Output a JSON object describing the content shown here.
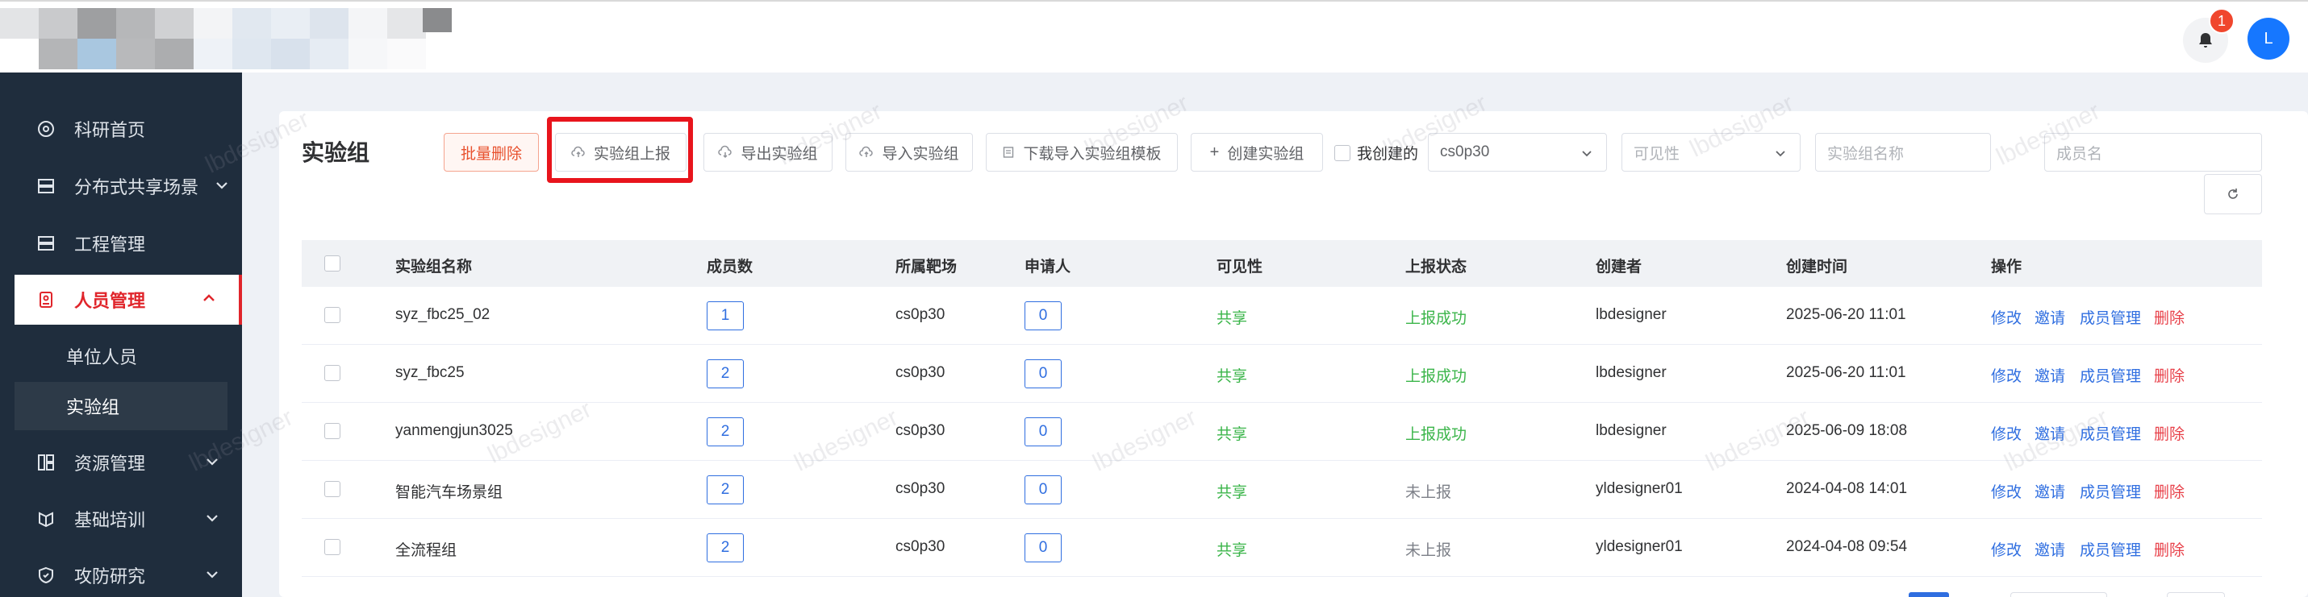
{
  "header": {
    "notification_count": "1",
    "avatar_initial": "L"
  },
  "sidebar": {
    "items": [
      {
        "label": "科研首页",
        "icon": "dashboard-icon"
      },
      {
        "label": "分布式共享场景",
        "icon": "server-icon"
      },
      {
        "label": "工程管理",
        "icon": "server-icon"
      },
      {
        "label": "人员管理",
        "icon": "person-badge-icon",
        "active": true
      },
      {
        "label": "资源管理",
        "icon": "grid-icon"
      },
      {
        "label": "基础培训",
        "icon": "training-icon"
      },
      {
        "label": "攻防研究",
        "icon": "shield-icon"
      }
    ],
    "sub_items": [
      {
        "label": "单位人员"
      },
      {
        "label": "实验组",
        "active": true
      }
    ]
  },
  "main": {
    "title": "实验组",
    "toolbar": {
      "batch_delete": "批量删除",
      "report": "实验组上报",
      "export": "导出实验组",
      "import": "导入实验组",
      "download_template": "下载导入实验组模板",
      "create": "创建实验组",
      "mine_label": "我创建的",
      "range_value": "cs0p30",
      "visibility_placeholder": "可见性",
      "group_name_placeholder": "实验组名称",
      "member_name_placeholder": "成员名"
    },
    "table": {
      "headers": [
        "实验组名称",
        "成员数",
        "所属靶场",
        "申请人",
        "可见性",
        "上报状态",
        "创建者",
        "创建时间",
        "操作"
      ],
      "actions": [
        "修改",
        "邀请",
        "成员管理",
        "删除"
      ],
      "rows": [
        {
          "name": "syz_fbc25_02",
          "members": "1",
          "range": "cs0p30",
          "applicants": "0",
          "visibility": "共享",
          "status": "上报成功",
          "creator": "lbdesigner",
          "created": "2025-06-20 11:01"
        },
        {
          "name": "syz_fbc25",
          "members": "2",
          "range": "cs0p30",
          "applicants": "0",
          "visibility": "共享",
          "status": "上报成功",
          "creator": "lbdesigner",
          "created": "2025-06-20 11:01"
        },
        {
          "name": "yanmengjun3025",
          "members": "2",
          "range": "cs0p30",
          "applicants": "0",
          "visibility": "共享",
          "status": "上报成功",
          "creator": "lbdesigner",
          "created": "2025-06-09 18:08"
        },
        {
          "name": "智能汽车场景组",
          "members": "2",
          "range": "cs0p30",
          "applicants": "0",
          "visibility": "共享",
          "status": "未上报",
          "creator": "yldesigner01",
          "created": "2024-04-08 14:01"
        },
        {
          "name": "全流程组",
          "members": "2",
          "range": "cs0p30",
          "applicants": "0",
          "visibility": "共享",
          "status": "未上报",
          "creator": "yldesigner01",
          "created": "2024-04-08 09:54"
        }
      ]
    },
    "watermark": "lbdesigner"
  },
  "colors": {
    "sidebar_bg": "#1f2d3d",
    "active_red": "#e0252b",
    "link_blue": "#2f6ee0",
    "success_green": "#3bb54a",
    "highlight_box": "#e8141c"
  }
}
